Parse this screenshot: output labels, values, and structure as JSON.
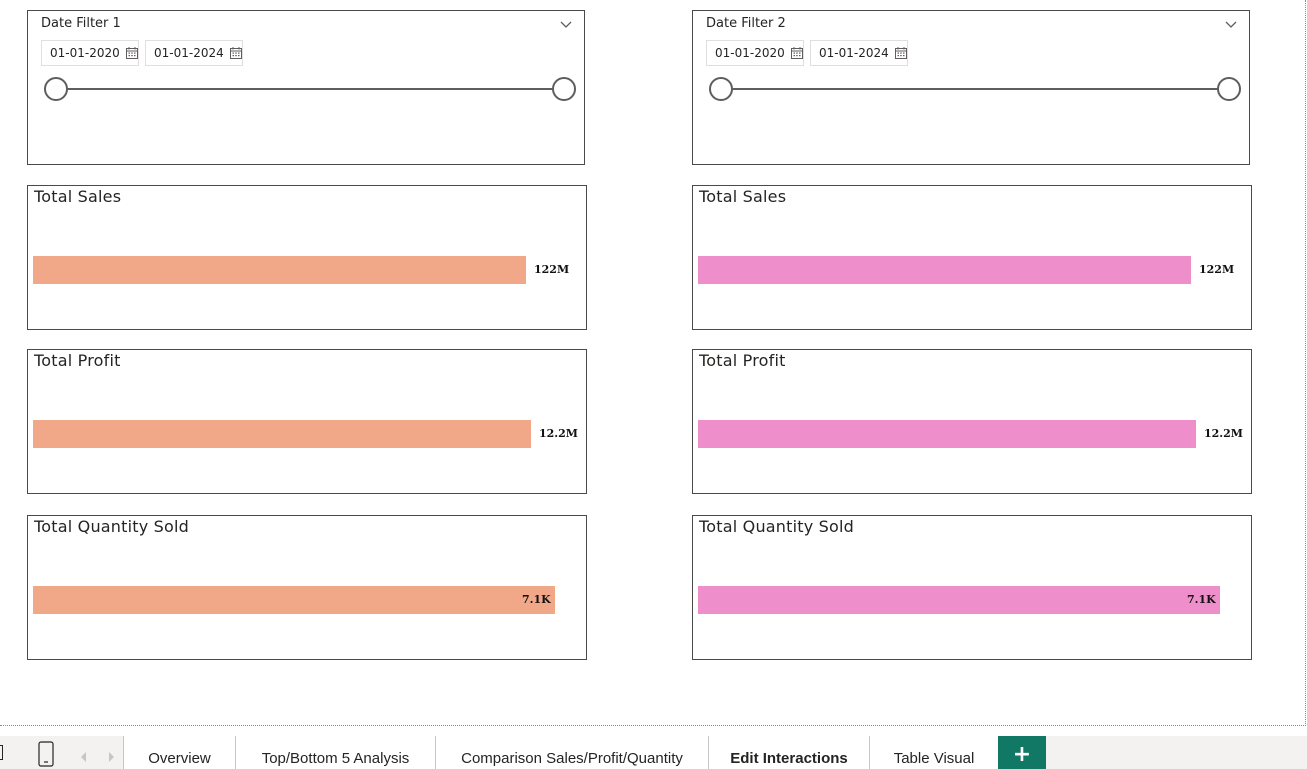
{
  "slicers": [
    {
      "title": "Date Filter 1",
      "start_date": "01-01-2020",
      "end_date": "01-01-2024"
    },
    {
      "title": "Date Filter 2",
      "start_date": "01-01-2020",
      "end_date": "01-01-2024"
    }
  ],
  "cards": {
    "left": [
      {
        "title": "Total Sales",
        "value_label": "122M"
      },
      {
        "title": "Total Profit",
        "value_label": "12.2M"
      },
      {
        "title": "Total Quantity Sold",
        "value_label": "7.1K"
      }
    ],
    "right": [
      {
        "title": "Total Sales",
        "value_label": "122M"
      },
      {
        "title": "Total Profit",
        "value_label": "12.2M"
      },
      {
        "title": "Total Quantity Sold",
        "value_label": "7.1K"
      }
    ]
  },
  "colors": {
    "left_bar": "#f0a889",
    "right_bar": "#ee8fcb",
    "add_tab": "#117865"
  },
  "tabs": [
    {
      "label": "Overview"
    },
    {
      "label": "Top/Bottom 5 Analysis"
    },
    {
      "label": "Comparison Sales/Profit/Quantity"
    },
    {
      "label": "Edit Interactions",
      "active": true
    },
    {
      "label": "Table Visual"
    }
  ],
  "add_tab_label": "+",
  "icons": {
    "page_nav": "page-icon",
    "mobile": "phone-layout-icon",
    "prev": "chevron-left-icon",
    "next": "chevron-right-icon",
    "calendar": "calendar-icon",
    "dropdown": "chevron-down-icon"
  }
}
